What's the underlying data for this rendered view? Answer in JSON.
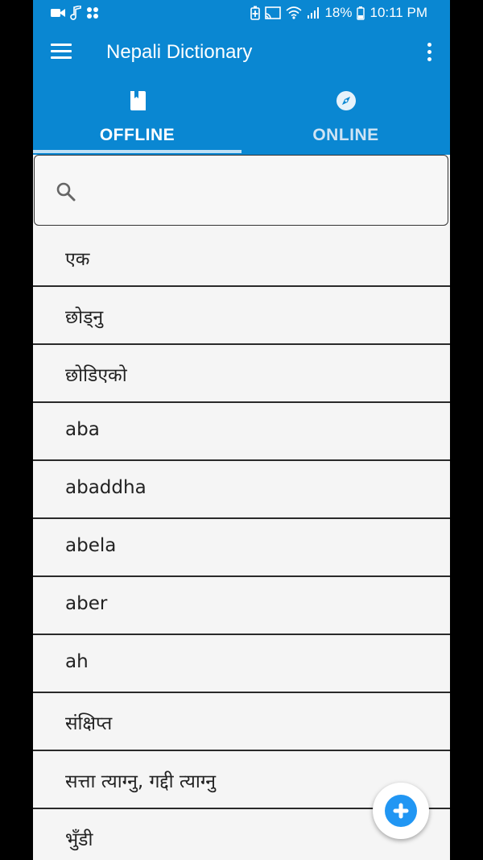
{
  "status_bar": {
    "icons_left": [
      "video-icon",
      "music-note-icon",
      "apps-icon"
    ],
    "icons_right": [
      "battery-saver-icon",
      "cast-icon",
      "wifi-icon",
      "signal-icon",
      "battery-icon"
    ],
    "battery": "18%",
    "time": "10:11 PM"
  },
  "toolbar": {
    "title": "Nepali Dictionary",
    "menu_icon": "hamburger-menu-icon",
    "overflow_icon": "more-vert-icon"
  },
  "tabs": [
    {
      "label": "OFFLINE",
      "icon": "book-icon",
      "active": true
    },
    {
      "label": "ONLINE",
      "icon": "compass-icon",
      "active": false
    }
  ],
  "search": {
    "placeholder": "",
    "value": "",
    "icon": "search-icon"
  },
  "words": [
    "एक",
    "छोड्नु",
    "छोडिएको",
    "aba",
    "abaddha",
    "abela",
    "aber",
    "ah",
    "संक्षिप्त",
    "सत्ता त्याग्नु, गद्दी त्याग्नु",
    "भुँडी"
  ],
  "fab": {
    "icon": "add-icon"
  },
  "colors": {
    "primary": "#0a87d2",
    "fab_accent": "#2196f3",
    "background": "#f5f5f5"
  }
}
